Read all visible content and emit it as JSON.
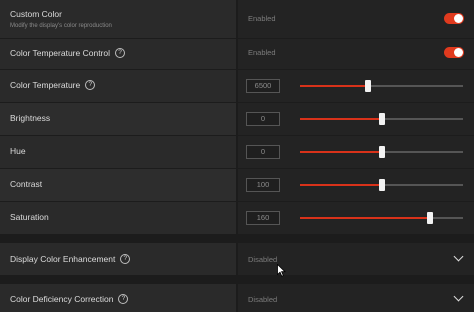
{
  "custom_color": {
    "label": "Custom Color",
    "description": "Modify the display's color reproduction",
    "status": "Enabled",
    "enabled": true
  },
  "color_temp_control": {
    "label": "Color Temperature Control",
    "status": "Enabled",
    "enabled": true
  },
  "sliders": [
    {
      "label": "Color Temperature",
      "value": "6500",
      "fraction": 0.42,
      "has_help": true
    },
    {
      "label": "Brightness",
      "value": "0",
      "fraction": 0.5,
      "has_help": false
    },
    {
      "label": "Hue",
      "value": "0",
      "fraction": 0.5,
      "has_help": false
    },
    {
      "label": "Contrast",
      "value": "100",
      "fraction": 0.5,
      "has_help": false
    },
    {
      "label": "Saturation",
      "value": "160",
      "fraction": 0.8,
      "has_help": false
    }
  ],
  "display_color_enhancement": {
    "label": "Display Color Enhancement",
    "value": "Disabled"
  },
  "color_deficiency_correction": {
    "label": "Color Deficiency Correction",
    "value": "Disabled"
  },
  "help_glyph": "?",
  "colors": {
    "accent": "#d8321a",
    "toggle_on": "#e03a1e",
    "panel_bg": "#1c1c1c"
  }
}
